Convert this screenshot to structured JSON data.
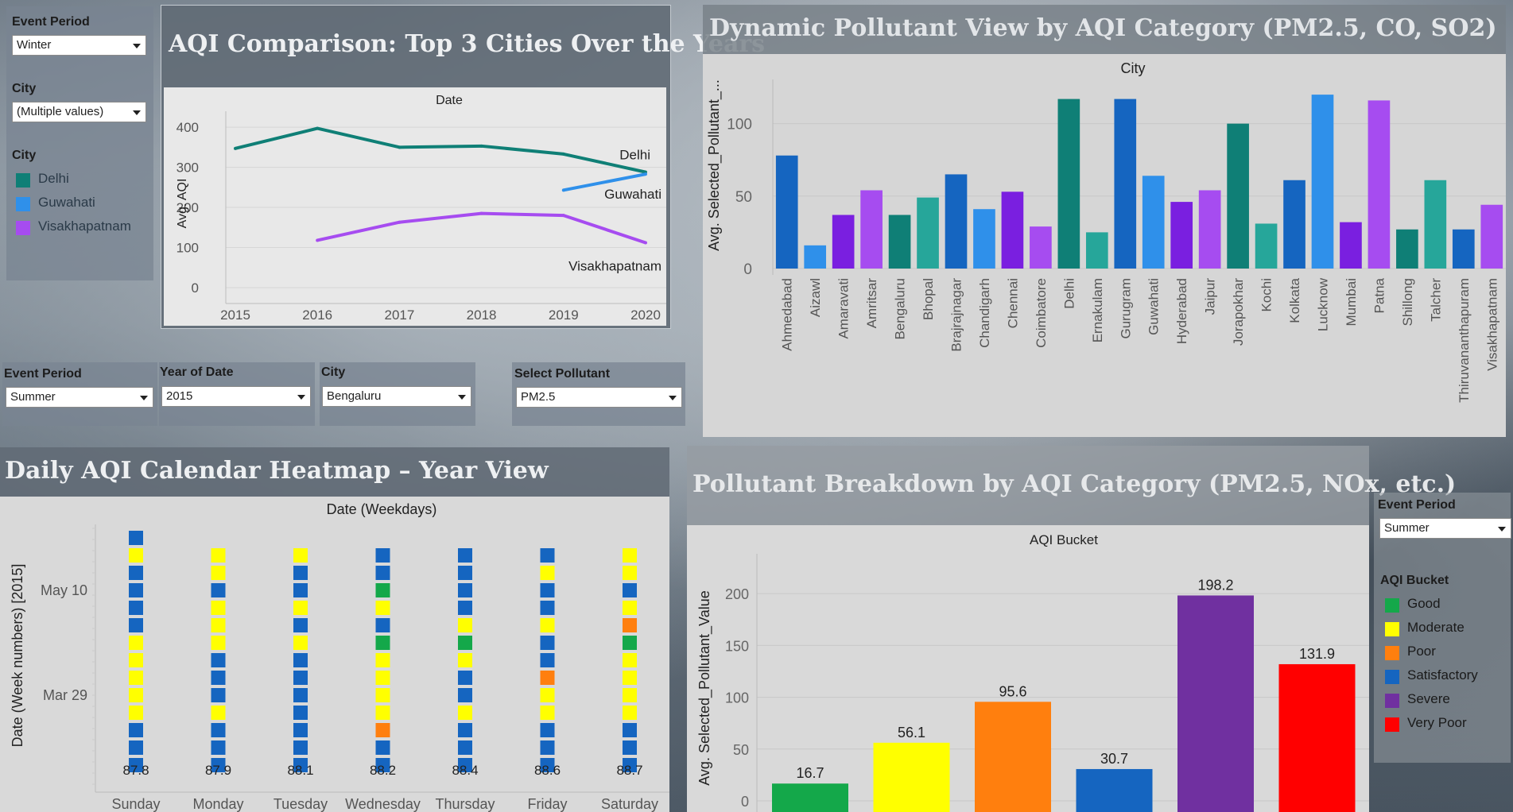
{
  "left_filters": {
    "event_period_label": "Event Period",
    "event_period_value": "Winter",
    "city_label": "City",
    "city_value": "(Multiple values)",
    "legend_title": "City",
    "legend": [
      {
        "label": "Delhi",
        "color": "#0f7f76"
      },
      {
        "label": "Guwahati",
        "color": "#2f90ea"
      },
      {
        "label": "Visakhapatnam",
        "color": "#a64cf0"
      }
    ]
  },
  "mid_filters": {
    "event_period_label": "Event Period",
    "event_period_value": "Summer",
    "year_label": "Year of Date",
    "year_value": "2015",
    "city_label": "City",
    "city_value": "Bengaluru",
    "pollutant_label": "Select Pollutant",
    "pollutant_value": "PM2.5"
  },
  "right_filters": {
    "event_period_label": "Event Period",
    "event_period_value": "Summer",
    "legend_title": "AQI Bucket",
    "legend": [
      {
        "label": "Good",
        "color": "#14a84a"
      },
      {
        "label": "Moderate",
        "color": "#ffff00"
      },
      {
        "label": "Poor",
        "color": "#ff7f0e"
      },
      {
        "label": "Satisfactory",
        "color": "#1565c0"
      },
      {
        "label": "Severe",
        "color": "#7030a0"
      },
      {
        "label": "Very Poor",
        "color": "#ff0000"
      }
    ]
  },
  "panels": {
    "line_title": "AQI Comparison: Top 3 Cities Over the Years",
    "city_bar_title": "Dynamic Pollutant View by AQI Category (PM2.5, CO, SO2)",
    "heatmap_title": "Daily AQI Calendar Heatmap – Year View",
    "bucket_bar_title": "Pollutant Breakdown by AQI Category (PM2.5, NOx, etc.)"
  },
  "chart_data": [
    {
      "type": "line",
      "title": "AQI Comparison: Top 3 Cities Over the Years",
      "header": "Date",
      "ylabel": "Avg. AQI",
      "x": [
        2015,
        2016,
        2017,
        2018,
        2019,
        2020
      ],
      "ylim": [
        0,
        420
      ],
      "yticks": [
        0,
        100,
        200,
        300,
        400
      ],
      "series": [
        {
          "name": "Delhi",
          "color": "#0f7f76",
          "values": [
            347,
            397,
            350,
            353,
            333,
            288
          ]
        },
        {
          "name": "Guwahati",
          "color": "#2f90ea",
          "values": [
            null,
            null,
            null,
            null,
            243,
            283
          ]
        },
        {
          "name": "Visakhapatnam",
          "color": "#a64cf0",
          "values": [
            null,
            118,
            163,
            185,
            180,
            112
          ]
        }
      ]
    },
    {
      "type": "bar",
      "title": "Dynamic Pollutant View by AQI Category (PM2.5, CO, SO2)",
      "header": "City",
      "ylabel": "Avg. Selected_Pollutant_...",
      "ylim": [
        0,
        125
      ],
      "yticks": [
        0,
        50,
        100
      ],
      "categories": [
        "Ahmedabad",
        "Aizawl",
        "Amaravati",
        "Amritsar",
        "Bengaluru",
        "Bhopal",
        "Brajrajnagar",
        "Chandigarh",
        "Chennai",
        "Coimbatore",
        "Delhi",
        "Ernakulam",
        "Gurugram",
        "Guwahati",
        "Hyderabad",
        "Jaipur",
        "Jorapokhar",
        "Kochi",
        "Kolkata",
        "Lucknow",
        "Mumbai",
        "Patna",
        "Shillong",
        "Talcher",
        "Thiruvananthapuram",
        "Visakhapatnam"
      ],
      "values": [
        78,
        16,
        37,
        54,
        37,
        49,
        65,
        41,
        53,
        29,
        117,
        25,
        117,
        64,
        46,
        54,
        100,
        31,
        61,
        120,
        32,
        116,
        27,
        61,
        27,
        44
      ],
      "colors": [
        "#1565c0",
        "#2f90ea",
        "#7a1fe0",
        "#a64cf0",
        "#0f7f76",
        "#26a69a",
        "#1565c0",
        "#2f90ea",
        "#7a1fe0",
        "#a64cf0",
        "#0f7f76",
        "#26a69a",
        "#1565c0",
        "#2f90ea",
        "#7a1fe0",
        "#a64cf0",
        "#0f7f76",
        "#26a69a",
        "#1565c0",
        "#2f90ea",
        "#7a1fe0",
        "#a64cf0",
        "#0f7f76",
        "#26a69a",
        "#1565c0",
        "#a64cf0"
      ]
    },
    {
      "type": "heatmap",
      "title": "Daily AQI Calendar Heatmap – Year View",
      "header": "Date (Weekdays)",
      "ylabel": "Date (Week numbers) [2015]",
      "days": [
        "Sunday",
        "Monday",
        "Tuesday",
        "Wednesday",
        "Thursday",
        "Friday",
        "Saturday"
      ],
      "ytick_labels": [
        {
          "label": "May 10",
          "row": 3
        },
        {
          "label": "Mar 29",
          "row": 9
        }
      ],
      "day_totals": [
        "87.8",
        "87.9",
        "88.1",
        "88.2",
        "88.4",
        "88.6",
        "88.7"
      ],
      "bucket_colors": {
        "S": "#1565c0",
        "M": "#ffff00",
        "G": "#14a84a",
        "P": "#ff7f0e"
      },
      "columns": [
        "SMSSSSMMMMMSSS",
        "-MMSMMMSSSMSSS",
        "-MSSMSMSSSSSSS",
        "-SSGMSGMMMMPSS",
        "-SSSSMGMSSMSSS",
        "-SMSSMSSPMMSSS",
        "-MMSMPGMMMMSSS"
      ]
    },
    {
      "type": "bar",
      "title": "Pollutant Breakdown by AQI Category (PM2.5, NOx, etc.)",
      "header": "AQI Bucket",
      "ylabel": "Avg. Selected_Pollutant_Value",
      "ylim": [
        0,
        230
      ],
      "yticks": [
        0,
        50,
        100,
        150,
        200
      ],
      "categories": [
        "Good",
        "Moderate",
        "Poor",
        "Satisfactory",
        "Severe",
        "Very Poor"
      ],
      "values": [
        16.7,
        56.1,
        95.6,
        30.7,
        198.2,
        131.9
      ],
      "labels": [
        "16.7",
        "56.1",
        "95.6",
        "30.7",
        "198.2",
        "131.9"
      ],
      "colors": [
        "#14a84a",
        "#ffff00",
        "#ff7f0e",
        "#1565c0",
        "#7030a0",
        "#ff0000"
      ]
    }
  ]
}
